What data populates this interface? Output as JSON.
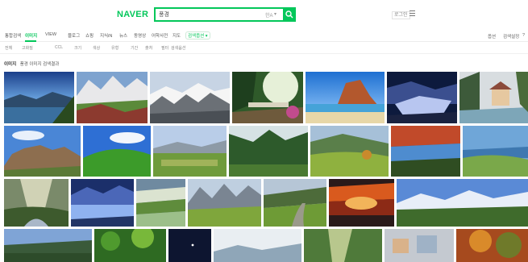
{
  "header": {
    "logo": "NAVER",
    "search_value": "풍경",
    "kbd_label": "한A",
    "header_link": "로그인"
  },
  "tabs": [
    {
      "label": "통합검색",
      "active": false
    },
    {
      "label": "이미지",
      "active": true
    },
    {
      "label": "VIEW",
      "active": false
    },
    {
      "label": "블로그",
      "active": false
    },
    {
      "label": "쇼핑",
      "active": false
    },
    {
      "label": "지식iN",
      "active": false
    },
    {
      "label": "뉴스",
      "active": false
    },
    {
      "label": "동영상",
      "active": false
    },
    {
      "label": "어학사전",
      "active": false
    },
    {
      "label": "지도",
      "active": false
    }
  ],
  "tab_more": "검색옵션 ▾",
  "right_links": [
    "옵션",
    "검색설정",
    "?"
  ],
  "filters": [
    "전체",
    "고화질",
    "CCL",
    "크기",
    "색상",
    "유형",
    "기간",
    "출처",
    "필터",
    "검색옵션"
  ],
  "section": {
    "title": "이미지",
    "subtitle": "풍경 이미지 검색결과"
  },
  "images": [
    {
      "alt": "Lake with mountains at dusk"
    },
    {
      "alt": "Snowy mountain range"
    },
    {
      "alt": "Cloud-covered peaks"
    },
    {
      "alt": "Garden with stone bridge"
    },
    {
      "alt": "Beach with red rocks"
    },
    {
      "alt": "Reflective lake at twilight"
    },
    {
      "alt": "Cottage by a river"
    },
    {
      "alt": "Rocky hill under blue sky"
    },
    {
      "alt": "Green rolling hill"
    },
    {
      "alt": "Mountain meadow"
    },
    {
      "alt": "Forest clearing"
    },
    {
      "alt": "Green valley"
    },
    {
      "alt": "Autumn lakeside"
    },
    {
      "alt": "Coastal cliffs"
    },
    {
      "alt": "River valley with sunbeams"
    },
    {
      "alt": "Blue lake at night"
    },
    {
      "alt": "Rice terraces"
    },
    {
      "alt": "Alpine valley"
    },
    {
      "alt": "Mountain road"
    },
    {
      "alt": "Red canyon"
    },
    {
      "alt": "Wide mountain landscape"
    },
    {
      "alt": "Hillside village"
    },
    {
      "alt": "Tropical greenery"
    },
    {
      "alt": "Night sky"
    },
    {
      "alt": "Clouds over mountains"
    },
    {
      "alt": "Light beams over meadow"
    },
    {
      "alt": "Painted village"
    },
    {
      "alt": "Autumn forest"
    }
  ],
  "colors": {
    "brand_green": "#03c75a"
  }
}
